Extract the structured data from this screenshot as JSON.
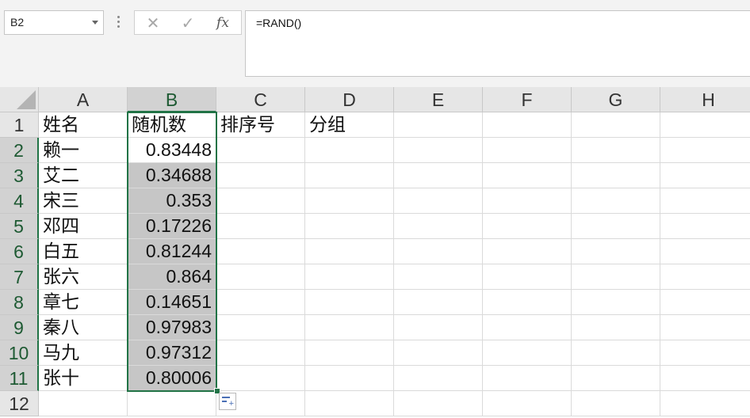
{
  "name_box": "B2",
  "formula": "=RAND()",
  "fx_buttons": {
    "cancel": "✕",
    "enter": "✓",
    "fx": "fx"
  },
  "columns": [
    "A",
    "B",
    "C",
    "D",
    "E",
    "F",
    "G",
    "H"
  ],
  "rows": [
    "1",
    "2",
    "3",
    "4",
    "5",
    "6",
    "7",
    "8",
    "9",
    "10",
    "11",
    "12"
  ],
  "cells": {
    "headers": [
      "姓名",
      "随机数",
      "排序号",
      "分组"
    ],
    "names": [
      "赖一",
      "艾二",
      "宋三",
      "邓四",
      "白五",
      "张六",
      "章七",
      "秦八",
      "马九",
      "张十"
    ],
    "values": [
      "0.83448",
      "0.34688",
      "0.353",
      "0.17226",
      "0.81244",
      "0.864",
      "0.14651",
      "0.97983",
      "0.97312",
      "0.80006"
    ]
  },
  "selection_color": "#217346"
}
